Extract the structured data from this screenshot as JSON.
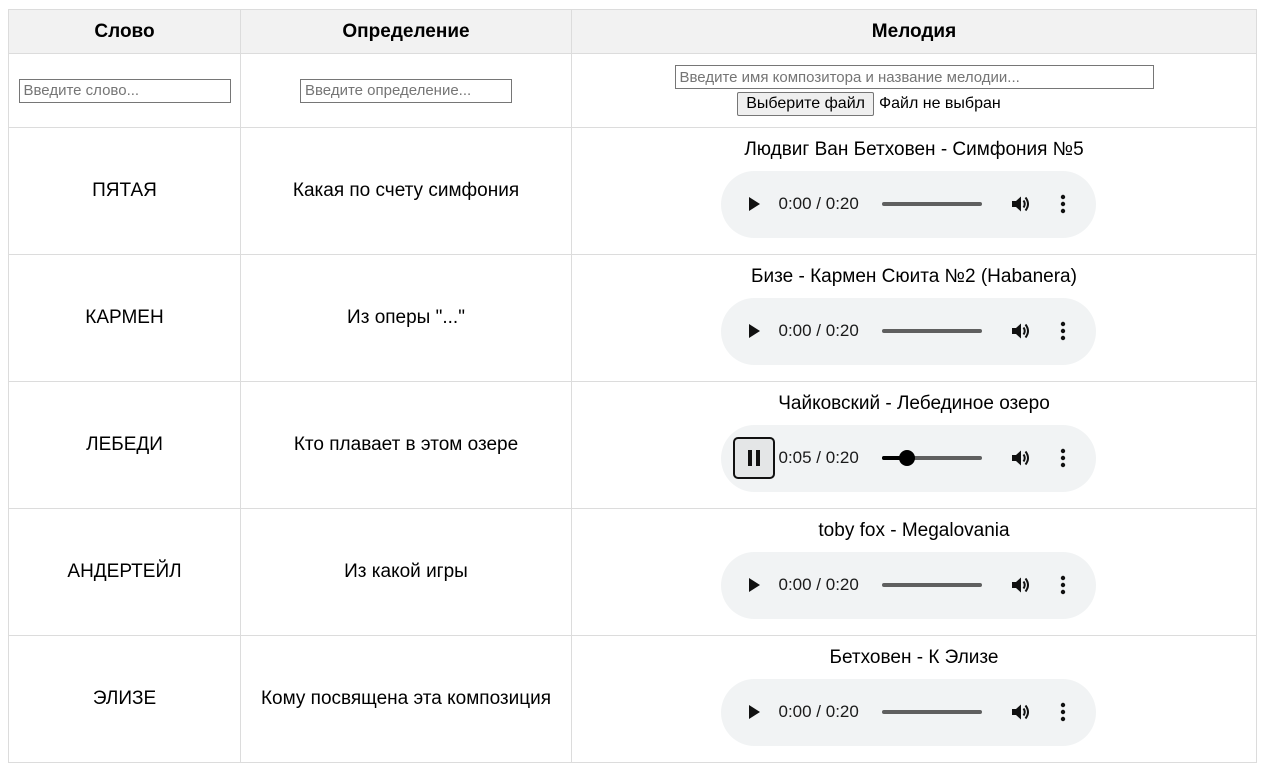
{
  "headers": {
    "word": "Слово",
    "definition": "Определение",
    "melody": "Мелодия"
  },
  "inputs": {
    "word_placeholder": "Введите слово...",
    "definition_placeholder": "Введите определение...",
    "melody_placeholder": "Введите имя композитора и название мелодии...",
    "file_button_label": "Выберите файл",
    "file_status": "Файл не выбран"
  },
  "rows": [
    {
      "word": "ПЯТАЯ",
      "definition": "Какая по счету симфония",
      "melody_title": "Людвиг Ван Бетховен - Симфония №5",
      "time": "0:00 / 0:20",
      "playing": false,
      "progress": 0
    },
    {
      "word": "КАРМЕН",
      "definition": "Из оперы \"...\"",
      "melody_title": "Бизе - Кармен Сюита №2 (Habanera)",
      "time": "0:00 / 0:20",
      "playing": false,
      "progress": 0
    },
    {
      "word": "ЛЕБЕДИ",
      "definition": "Кто плавает в этом озере",
      "melody_title": "Чайковский - Лебединое озеро",
      "time": "0:05 / 0:20",
      "playing": true,
      "progress": 0.25
    },
    {
      "word": "АНДЕРТЕЙЛ",
      "definition": "Из какой игры",
      "melody_title": "toby fox - Megalovania",
      "time": "0:00 / 0:20",
      "playing": false,
      "progress": 0
    },
    {
      "word": "ЭЛИЗЕ",
      "definition": "Кому посвящена эта композиция",
      "melody_title": "Бетховен - К Элизе",
      "time": "0:00 / 0:20",
      "playing": false,
      "progress": 0
    }
  ]
}
